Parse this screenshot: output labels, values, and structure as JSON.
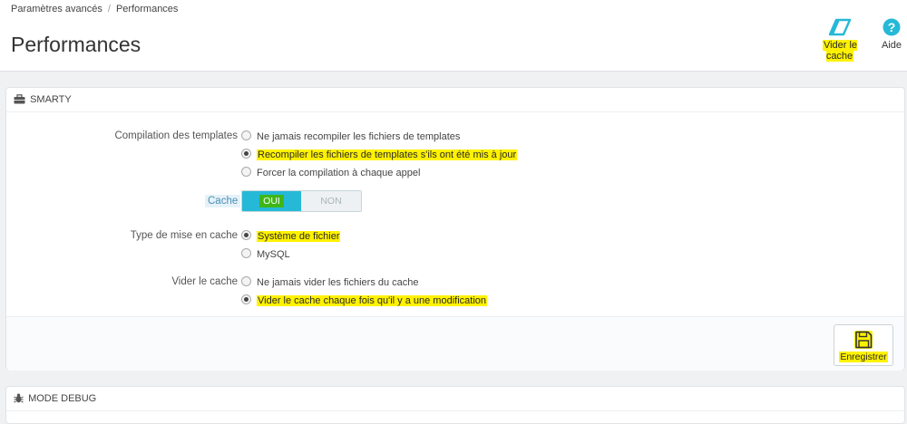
{
  "breadcrumb": {
    "parent": "Paramètres avancés",
    "separator": "/",
    "current": "Performances"
  },
  "page": {
    "title": "Performances"
  },
  "toolbar": {
    "clear_cache_label": "Vider le cache",
    "help_label": "Aide",
    "accent_color": "#25b9d7"
  },
  "smarty": {
    "heading": "SMARTY",
    "compilation": {
      "label": "Compilation des templates",
      "options": [
        {
          "label": "Ne jamais recompiler les fichiers de templates",
          "checked": false
        },
        {
          "label": "Recompiler les fichiers de templates s'ils ont été mis à jour",
          "checked": true
        },
        {
          "label": "Forcer la compilation à chaque appel",
          "checked": false
        }
      ]
    },
    "cache": {
      "label": "Cache",
      "on_label": "OUI",
      "off_label": "NON",
      "value": "OUI"
    },
    "cache_type": {
      "label": "Type de mise en cache",
      "options": [
        {
          "label": "Système de fichier",
          "checked": true
        },
        {
          "label": "MySQL",
          "checked": false
        }
      ]
    },
    "clear_cache": {
      "label": "Vider le cache",
      "options": [
        {
          "label": "Ne jamais vider les fichiers du cache",
          "checked": false
        },
        {
          "label": "Vider le cache chaque fois qu'il y a une modification",
          "checked": true
        }
      ]
    },
    "save_label": "Enregistrer"
  },
  "debug": {
    "heading": "MODE DEBUG"
  }
}
